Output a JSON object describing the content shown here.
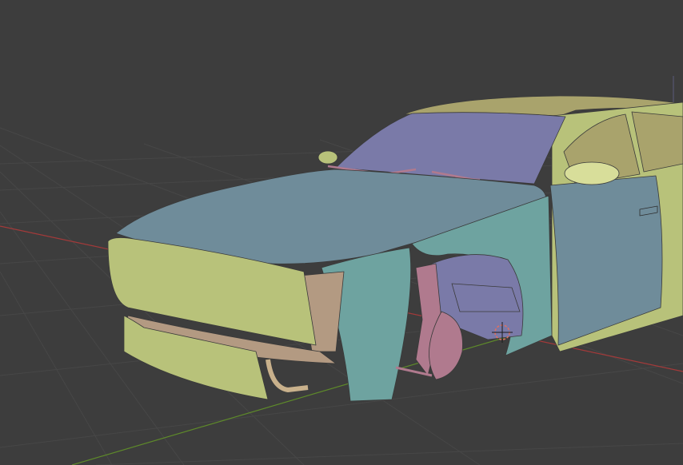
{
  "app": {
    "view": "3D Viewport",
    "shading_mode": "solid-random-color"
  },
  "colors": {
    "background": "#3d3d3d",
    "grid_line": "#474747",
    "x_axis": "#a33a3a",
    "y_axis": "#5e8a2a",
    "panel_green": "#b8c27a",
    "panel_blue": "#6f8c9a",
    "panel_teal": "#6ea3a0",
    "panel_purple": "#7a7aa8",
    "panel_pink": "#b07a8e",
    "panel_tan": "#b39a82",
    "panel_olive": "#a9a36c"
  },
  "scene": {
    "object_description": "car-body-model",
    "gizmo": "3d-cursor-icon"
  }
}
